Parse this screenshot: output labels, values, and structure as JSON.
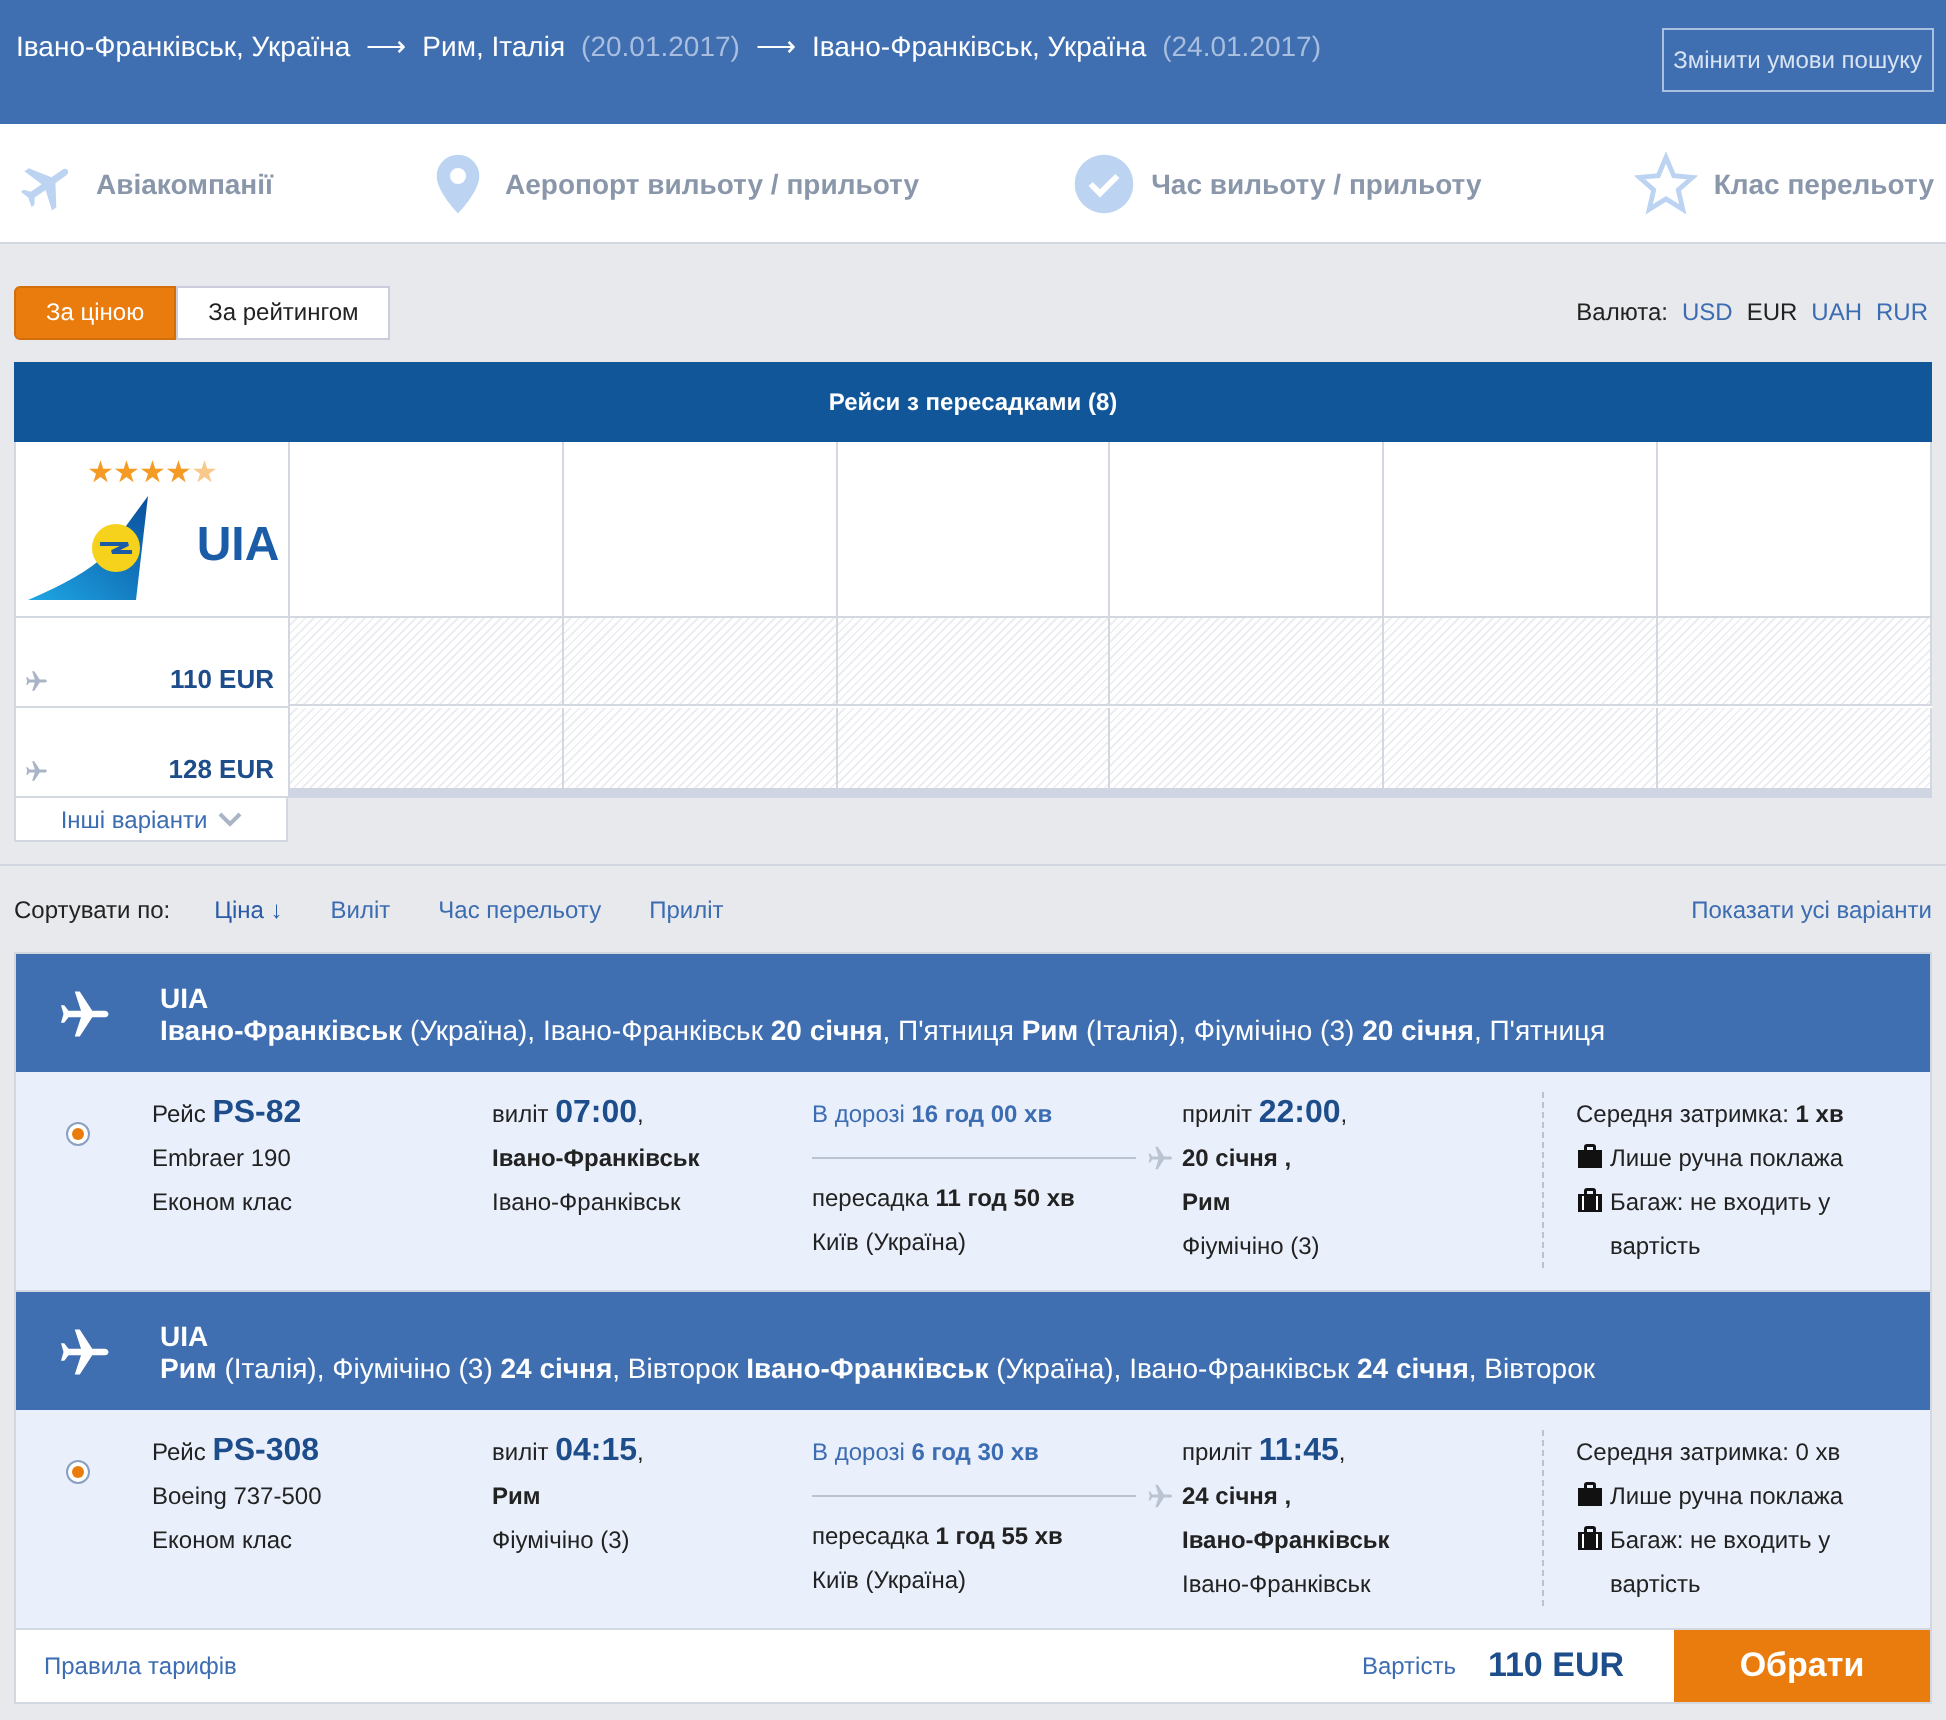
{
  "header": {
    "route": [
      {
        "kind": "place",
        "text": "Івано-Франківськ, Україна"
      },
      {
        "kind": "arrow",
        "text": "⟶"
      },
      {
        "kind": "place",
        "text": "Рим, Італія"
      },
      {
        "kind": "date",
        "text": "(20.01.2017)"
      },
      {
        "kind": "arrow",
        "text": "⟶"
      },
      {
        "kind": "place",
        "text": "Івано-Франківськ, Україна"
      },
      {
        "kind": "date",
        "text": "(24.01.2017)"
      }
    ],
    "change_button": "Змінити умови пошуку"
  },
  "filters": [
    {
      "kind": "plane",
      "label": "Авіакомпанії"
    },
    {
      "kind": "pin",
      "label": "Аеропорт вильоту / прильоту"
    },
    {
      "kind": "check",
      "label": "Час вильоту / прильоту"
    },
    {
      "kind": "star",
      "label": "Клас перельоту"
    }
  ],
  "sort_toggle": [
    {
      "label": "За ціною",
      "selected": true
    },
    {
      "label": "За рейтингом",
      "selected": false
    }
  ],
  "currency": {
    "label": "Валюта:",
    "options": [
      {
        "label": "USD",
        "selected": false
      },
      {
        "label": "EUR",
        "selected": true
      },
      {
        "label": "UAH",
        "selected": false
      },
      {
        "label": "RUR",
        "selected": false
      }
    ]
  },
  "matrix": {
    "title": "Рейси з пересадками (8)",
    "airline": {
      "stars": 4,
      "logo": "UIA"
    },
    "prices": [
      "110 EUR",
      "128 EUR"
    ],
    "more": "Інші варіанти"
  },
  "sort_bar": {
    "label": "Сортувати по:",
    "options": [
      {
        "label": "Ціна ↓",
        "selected": true
      },
      {
        "label": "Виліт",
        "selected": false
      },
      {
        "label": "Час перельоту",
        "selected": false
      },
      {
        "label": "Приліт",
        "selected": false
      }
    ],
    "show_all": "Показати усі варіанти"
  },
  "segments": [
    {
      "airline": "UIA",
      "route": "**Івано-Франківськ** (Україна), Івано-Франківськ **20 січня**, П'ятниця **Рим** (Італія), Фіумічіно (3) **20 січня**, П'ятниця",
      "selected": true,
      "flight": "Рейс **PS-82**",
      "aircraft": "Embraer 190",
      "cabin": "Економ клас",
      "departure": "виліт **07:00**,",
      "departure_city": "Івано-Франківськ",
      "departure_airport": "Івано-Франківськ",
      "duration": "В дорозі **16 год 00 хв**",
      "transfer": "пересадка **11 год 50 хв**",
      "transfer_city": "Київ (Україна)",
      "arrival": "приліт **22:00**,",
      "arrival_date": "20 січня ,",
      "arrival_city": "Рим",
      "arrival_airport": "Фіумічіно (3)",
      "delay": "Середня затримка: **1 хв**",
      "hand_luggage": "Лише ручна поклажа",
      "baggage": "Багаж: не входить у вартість"
    },
    {
      "airline": "UIA",
      "route": "**Рим** (Італія), Фіумічіно (3) **24 січня**, Вівторок **Івано-Франківськ** (Україна), Івано-Франківськ **24 січня**, Вівторок",
      "selected": true,
      "flight": "Рейс **PS-308**",
      "aircraft": "Boeing 737-500",
      "cabin": "Економ клас",
      "departure": "виліт **04:15**,",
      "departure_city": "Рим",
      "departure_airport": "Фіумічіно (3)",
      "duration": "В дорозі **6 год 30 хв**",
      "transfer": "пересадка **1 год 55 хв**",
      "transfer_city": "Київ (Україна)",
      "arrival": "приліт **11:45**,",
      "arrival_date": "24 січня ,",
      "arrival_city": "Івано-Франківськ",
      "arrival_airport": "Івано-Франківськ",
      "delay": "Середня затримка: 0 хв",
      "hand_luggage": "Лише ручна поклажа",
      "baggage": "Багаж: не входить у вартість"
    }
  ],
  "footer": {
    "rules": "Правила тарифів",
    "price_label": "Вартість",
    "price": "110 EUR",
    "button": "Обрати"
  }
}
